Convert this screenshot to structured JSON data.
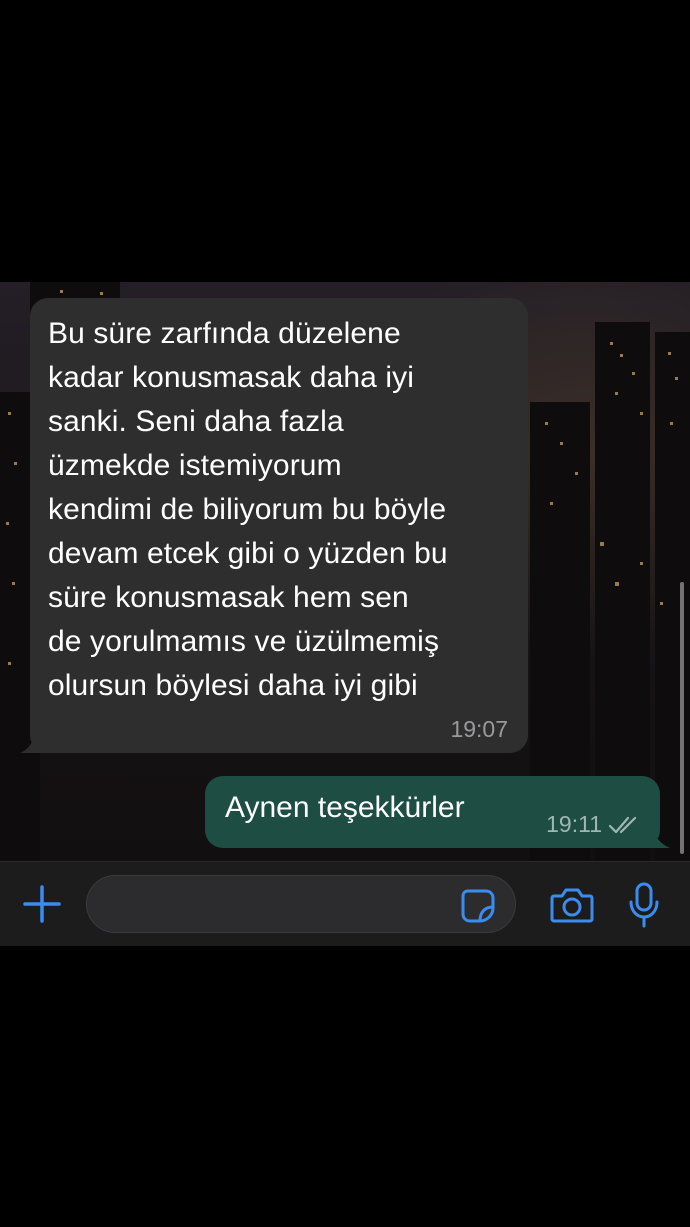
{
  "conversation": {
    "incoming_message": {
      "text": "Bu süre zarfında düzelene\nkadar konusmasak daha iyi\nsanki. Seni daha fazla\nüzmekde istemiyorum\nkendimi de biliyorum bu böyle\ndevam etcek gibi o yüzden bu\nsüre  konusmasak hem sen\nde yorulmamıs ve üzülmemiş\nolursun böylesi daha iyi gibi",
      "time": "19:07"
    },
    "outgoing_message": {
      "text": "Aynen teşekkürler",
      "time": "19:11",
      "status_icon": "double-check-icon"
    }
  },
  "composer": {
    "input_value": "",
    "icons": {
      "attach": "plus-icon",
      "sticker": "sticker-icon",
      "camera": "camera-icon",
      "voice": "microphone-icon"
    }
  },
  "colors": {
    "incoming_bubble": "#2e2e2f",
    "outgoing_bubble": "#1e4d44",
    "accent": "#3b8cf0",
    "timestamp": "#9a9a9c"
  }
}
